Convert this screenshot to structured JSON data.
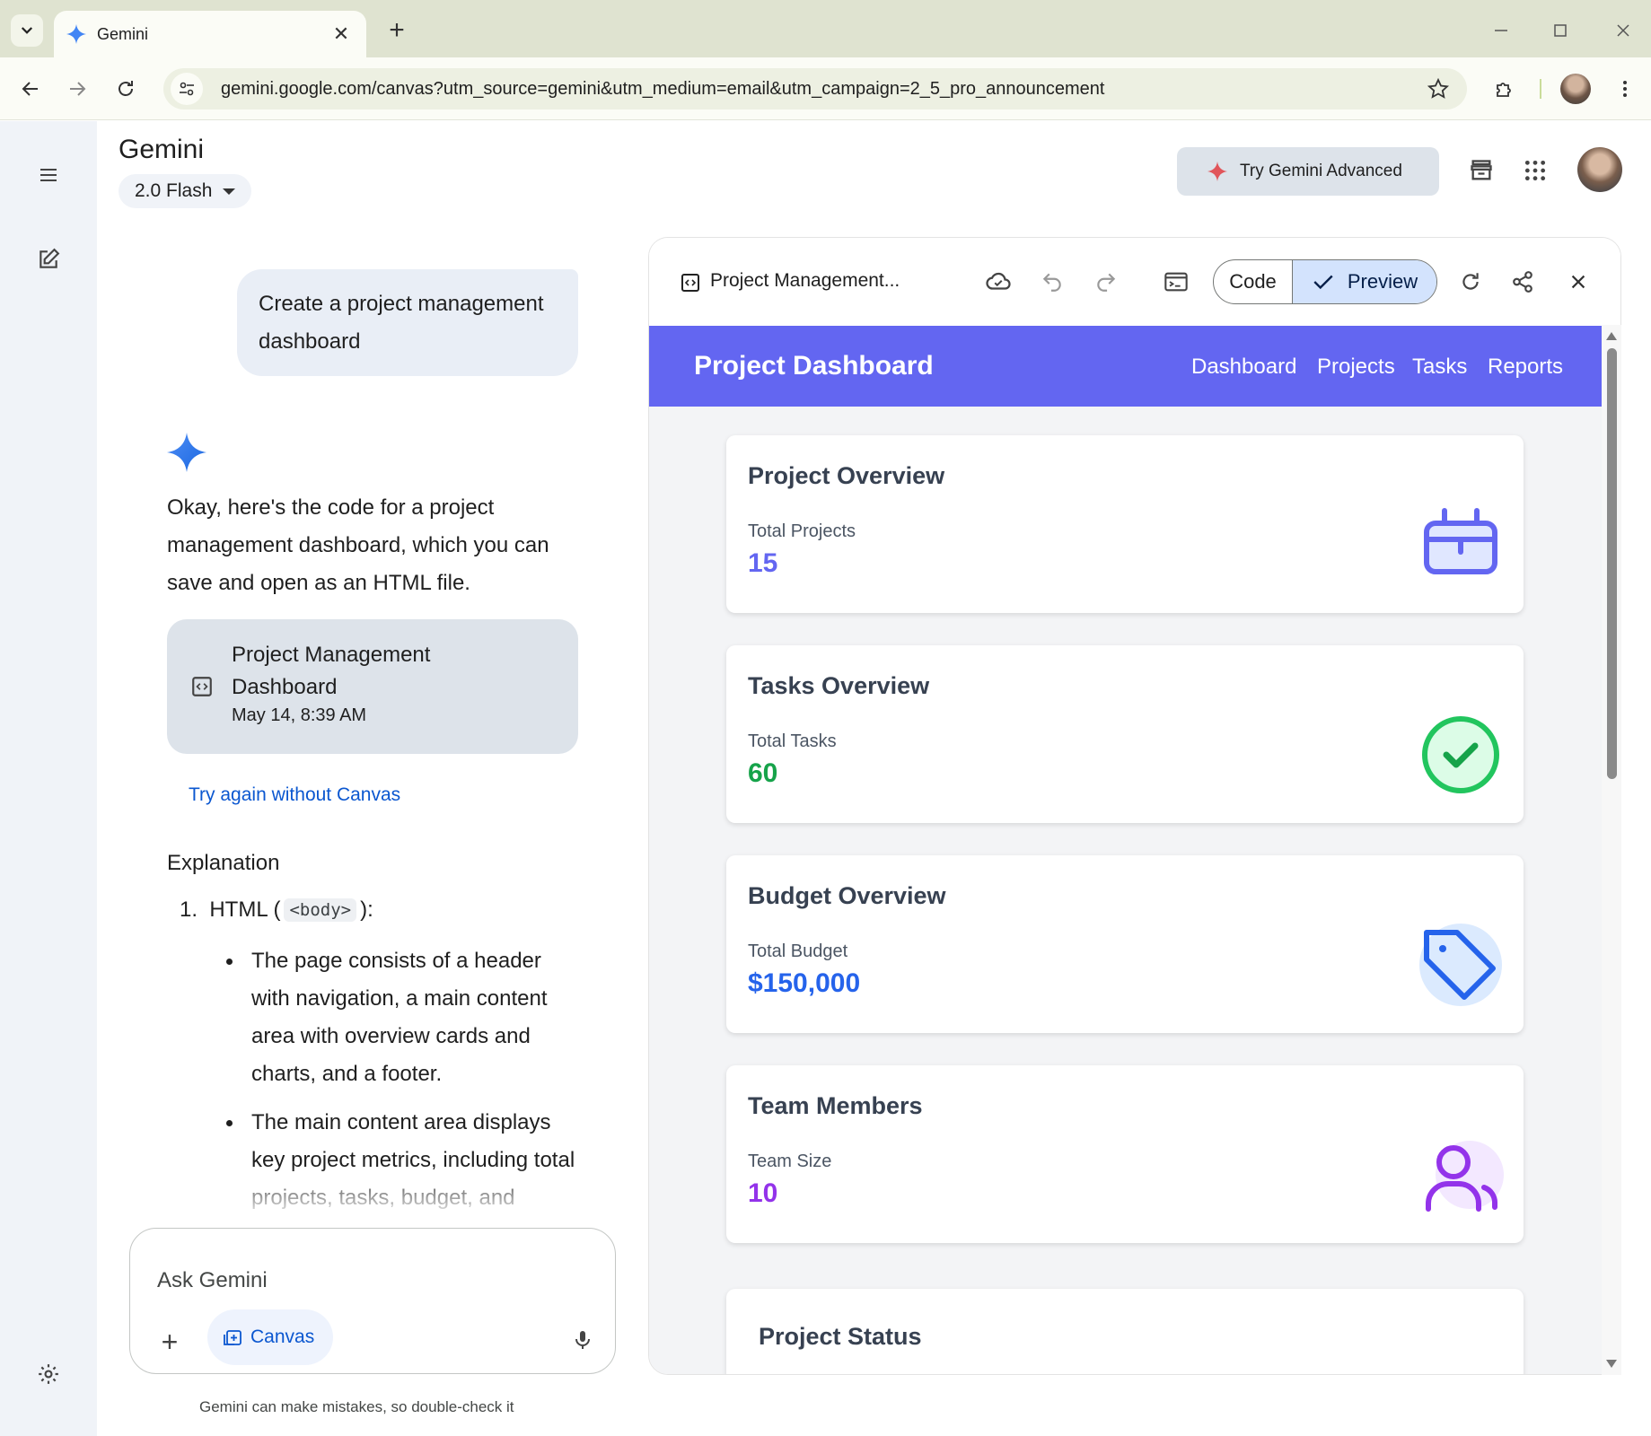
{
  "browser": {
    "tab_title": "Gemini",
    "url": "gemini.google.com/canvas?utm_source=gemini&utm_medium=email&utm_campaign=2_5_pro_announcement"
  },
  "app": {
    "title": "Gemini",
    "model": "2.0 Flash",
    "try_advanced": "Try Gemini Advanced"
  },
  "chat": {
    "user_prompt": "Create a project management dashboard",
    "response": "Okay, here's the code for a project management dashboard, which you can save and open as an HTML file.",
    "artifact": {
      "title": "Project Management Dashboard",
      "date": "May 14, 8:39 AM"
    },
    "try_again": "Try again without Canvas",
    "explanation": {
      "heading": "Explanation",
      "item1_prefix": "1.  HTML (",
      "item1_code": "<body>",
      "item1_suffix": "):",
      "bullets": [
        "The page consists of a header with navigation, a main content area with overview cards and charts, and a footer.",
        "The main content area displays key project metrics, including total projects, tasks, budget, and"
      ]
    }
  },
  "input": {
    "placeholder": "Ask Gemini",
    "canvas_label": "Canvas",
    "disclaimer": "Gemini can make mistakes, so double-check it"
  },
  "canvas": {
    "title": "Project Management...",
    "code_label": "Code",
    "preview_label": "Preview"
  },
  "dashboard": {
    "title": "Project Dashboard",
    "nav": [
      "Dashboard",
      "Projects",
      "Tasks",
      "Reports"
    ],
    "cards": [
      {
        "title": "Project Overview",
        "label": "Total Projects",
        "value": "15",
        "color": "#6366f1",
        "icon": "briefcase-icon"
      },
      {
        "title": "Tasks Overview",
        "label": "Total Tasks",
        "value": "60",
        "color": "#16a34a",
        "icon": "check-circle-icon"
      },
      {
        "title": "Budget Overview",
        "label": "Total Budget",
        "value": "$150,000",
        "color": "#2563eb",
        "icon": "tag-icon"
      },
      {
        "title": "Team Members",
        "label": "Team Size",
        "value": "10",
        "color": "#9333ea",
        "icon": "user-icon"
      }
    ],
    "status_title": "Project Status"
  },
  "colors": {
    "accent_blue": "#0b57d0",
    "nav_purple": "#6366f1",
    "preview_toggle": "#d3e3fd"
  }
}
